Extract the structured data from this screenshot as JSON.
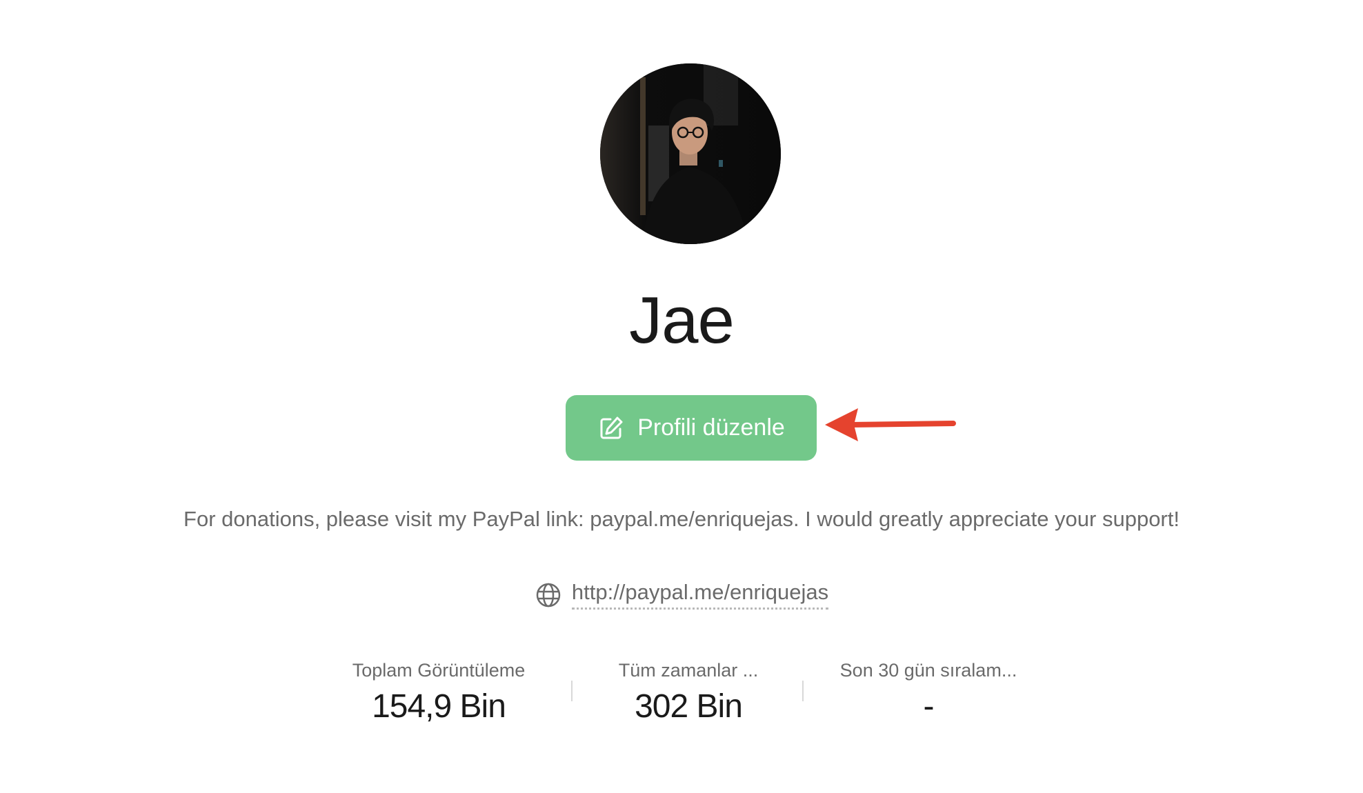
{
  "profile": {
    "name": "Jae",
    "edit_button_label": "Profili düzenle",
    "bio": "For donations, please visit my PayPal link: paypal.me/enriquejas. I would greatly appreciate your support!",
    "website": "http://paypal.me/enriquejas"
  },
  "stats": [
    {
      "label": "Toplam Görüntüleme",
      "value": "154,9 Bin"
    },
    {
      "label": "Tüm zamanlar ...",
      "value": "302 Bin"
    },
    {
      "label": "Son 30 gün sıralam...",
      "value": "-"
    }
  ],
  "colors": {
    "edit_button": "#73c88a",
    "annotation_arrow": "#e5432e",
    "muted_text": "#6a6a6a",
    "primary_text": "#1a1a1a"
  },
  "icons": {
    "edit": "edit-icon",
    "website": "globe-icon",
    "annotation": "arrow-annotation"
  }
}
